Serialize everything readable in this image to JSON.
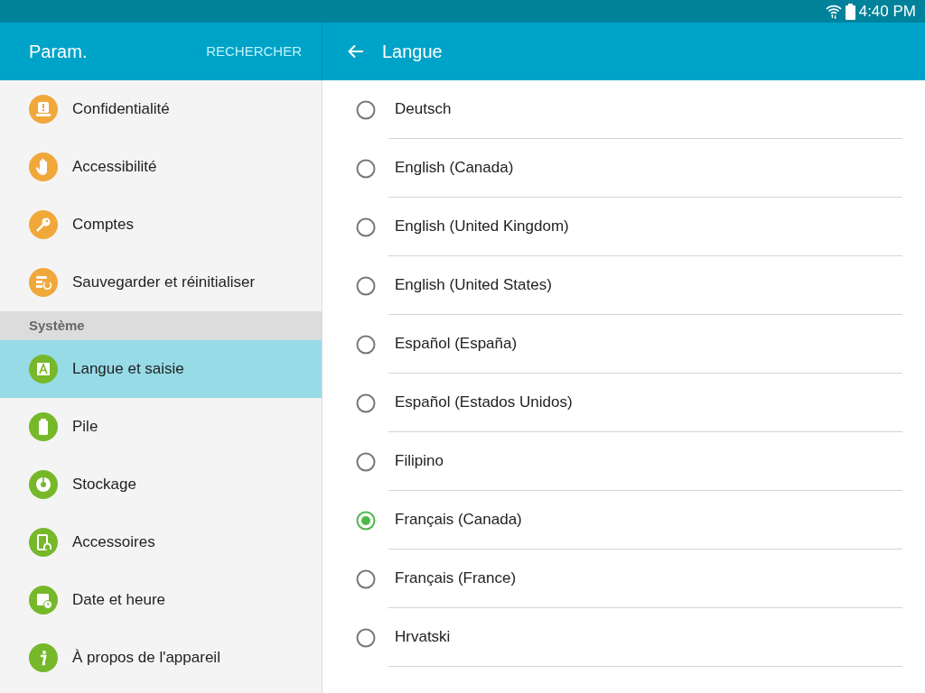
{
  "status_bar": {
    "time": "4:40 PM"
  },
  "sidebar": {
    "title": "Param.",
    "search_button": "RECHERCHER",
    "groups": [
      {
        "items": [
          {
            "label": "Confidentialité",
            "color": "#f0a83a",
            "selected": false
          },
          {
            "label": "Accessibilité",
            "color": "#f0a83a",
            "selected": false
          },
          {
            "label": "Comptes",
            "color": "#f0a83a",
            "selected": false
          },
          {
            "label": "Sauvegarder et réinitialiser",
            "color": "#f0a83a",
            "selected": false
          }
        ]
      },
      {
        "header": "Système",
        "items": [
          {
            "label": "Langue et saisie",
            "color": "#76b82a",
            "selected": true
          },
          {
            "label": "Pile",
            "color": "#76b82a",
            "selected": false
          },
          {
            "label": "Stockage",
            "color": "#76b82a",
            "selected": false
          },
          {
            "label": "Accessoires",
            "color": "#76b82a",
            "selected": false
          },
          {
            "label": "Date et heure",
            "color": "#76b82a",
            "selected": false
          },
          {
            "label": "À propos de l'appareil",
            "color": "#76b82a",
            "selected": false
          }
        ]
      }
    ]
  },
  "panel": {
    "title": "Langue",
    "languages": [
      {
        "label": "Deutsch",
        "selected": false
      },
      {
        "label": "English (Canada)",
        "selected": false
      },
      {
        "label": "English (United Kingdom)",
        "selected": false
      },
      {
        "label": "English (United States)",
        "selected": false
      },
      {
        "label": "Español (España)",
        "selected": false
      },
      {
        "label": "Español (Estados Unidos)",
        "selected": false
      },
      {
        "label": "Filipino",
        "selected": false
      },
      {
        "label": "Français (Canada)",
        "selected": true
      },
      {
        "label": "Français (France)",
        "selected": false
      },
      {
        "label": "Hrvatski",
        "selected": false
      }
    ]
  }
}
